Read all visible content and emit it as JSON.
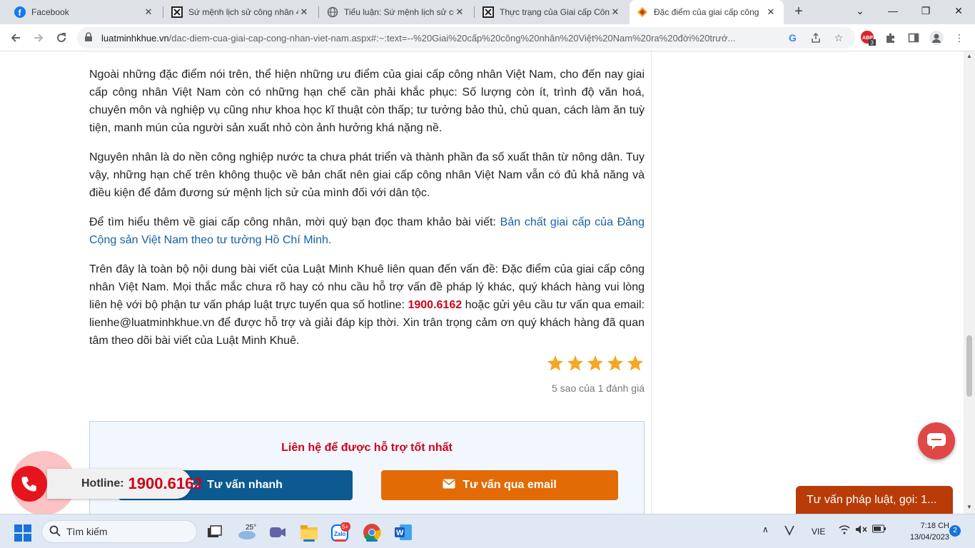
{
  "tabs": [
    {
      "title": "Facebook",
      "icon": "facebook-icon"
    },
    {
      "title": "Sứ mệnh lịch sử công nhân 4",
      "icon": "studocu-icon"
    },
    {
      "title": "Tiểu luận: Sứ mệnh lịch sử củ",
      "icon": "globe-icon"
    },
    {
      "title": "Thực trạng của Giai cấp Công",
      "icon": "studocu-icon"
    },
    {
      "title": "Đặc điểm của giai cấp công",
      "icon": "luatminhkhue-icon"
    }
  ],
  "omnibox": {
    "domain": "luatminhkhue.vn",
    "path": "/dac-diem-cua-giai-cap-cong-nhan-viet-nam.aspx#:~:text=--%20Giai%20cấp%20công%20nhân%20Việt%20Nam%20ra%20đời%20trướ..."
  },
  "extensions": {
    "adblock_badge": "3"
  },
  "article": {
    "p1": "Ngoài những đặc điểm nói trên, thể hiện những ưu điểm của giai cấp công nhân Việt Nam, cho đến nay giai cấp công nhân Việt Nam còn có những hạn chế cần phải khắc phục: Số lượng còn ít, trình độ văn hoá, chuyên môn và nghiệp vụ cũng như khoa học kĩ thuật còn thấp; tư tưởng bảo thủ, chủ quan, cách làm ăn tuỳ tiện, manh mún của người sản xuất nhỏ còn ảnh hưởng khá nặng nề.",
    "p2": "Nguyên nhân là do nền công nghiệp nước ta chưa phát triển và thành phần đa số xuất thân từ nông dân. Tuy vậy, những hạn chế trên không thuộc về bản chất nên giai cấp công nhân Việt Nam vẫn có đủ khả năng và điều kiện để đảm đương sứ mệnh lịch sử của mình đối với dân tộc.",
    "p3_prefix": "Để tìm hiểu thêm về giai cấp công nhân, mời quý bạn đọc tham khảo bài viết: ",
    "p3_link": "Bản chất giai cấp của Đảng Cộng sản Việt Nam theo tư tưởng Hồ Chí Minh.",
    "p4_a": "Trên đây là toàn bộ nội dung bài viết của Luật Minh Khuê liên quan đến vấn đề: Đặc điểm của giai cấp công nhân Việt Nam. Mọi thắc mắc chưa rõ hay có nhu cầu hỗ trợ vấn đề pháp lý khác, quý khách hàng vui lòng liên hệ với bộ phận tư vấn pháp luật trực tuyến qua số hotline: ",
    "p4_hotline": "1900.6162",
    "p4_b": " hoặc gửi yêu cầu tư vấn qua email: lienhe@luatminhkhue.vn để được hỗ trợ và giải đáp kịp thời. Xin trân trọng cảm ơn quý khách hàng đã quan tâm theo dõi bài viết của Luật Minh Khuê."
  },
  "rating": {
    "stars": 5,
    "max": 5,
    "text": "5 sao của 1 đánh giá",
    "color": "#f5a623"
  },
  "contact": {
    "title": "Liên hệ để được hỗ trợ tốt nhất",
    "quick_btn": "Tư vấn nhanh",
    "email_btn": "Tư vấn qua email"
  },
  "floating": {
    "hotline_label": "Hotline:",
    "hotline_number": "1900.6162",
    "legal_bar": "Tư vấn pháp luật, gọi: 1..."
  },
  "taskbar": {
    "search_placeholder": "Tìm kiếm",
    "weather": "25°",
    "zalo_badge": "5+",
    "lang": "VIE",
    "time": "7:18 CH",
    "date": "13/04/2023",
    "notifications": "2"
  }
}
